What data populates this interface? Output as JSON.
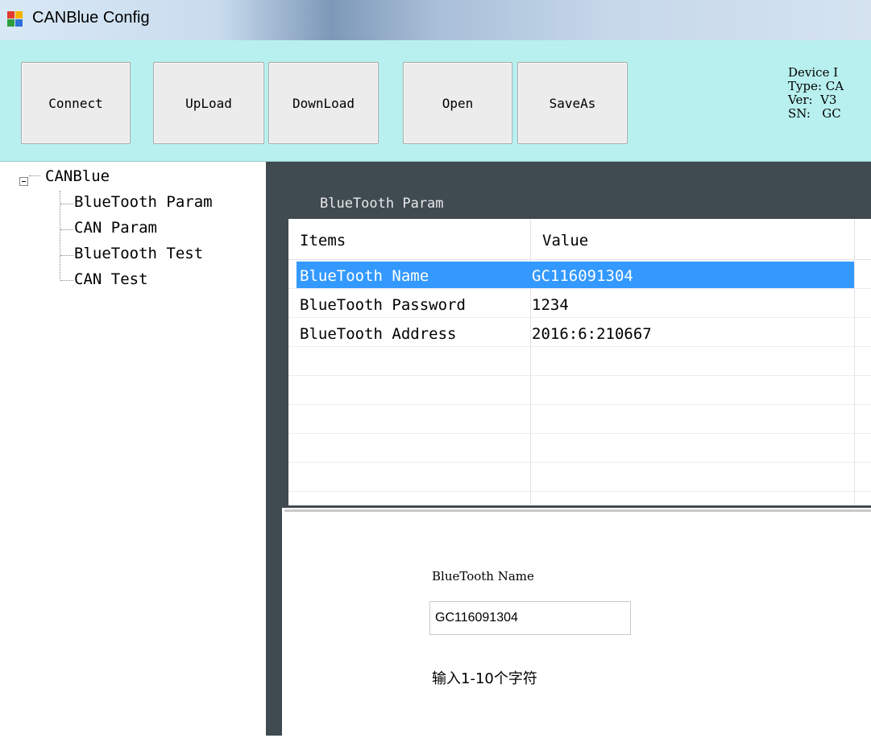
{
  "window": {
    "title": "CANBlue Config"
  },
  "toolbar": {
    "buttons": [
      {
        "label": "Connect"
      },
      {
        "label": "UpLoad"
      },
      {
        "label": "DownLoad"
      },
      {
        "label": "Open"
      },
      {
        "label": "SaveAs"
      }
    ]
  },
  "device_info": {
    "line1": "Device I",
    "line2": "Type: CA",
    "line3": "Ver:  V3",
    "line4": "SN:   GC"
  },
  "tree": {
    "root": "CANBlue",
    "items": [
      {
        "label": "BlueTooth Param"
      },
      {
        "label": "CAN Param"
      },
      {
        "label": "BlueTooth Test"
      },
      {
        "label": "CAN Test"
      }
    ]
  },
  "panel": {
    "title": "BlueTooth Param",
    "columns": [
      "Items",
      "Value"
    ],
    "rows": [
      {
        "item": "BlueTooth Name",
        "value": "GC116091304"
      },
      {
        "item": "BlueTooth Password",
        "value": "1234"
      },
      {
        "item": "BlueTooth Address",
        "value": "2016:6:210667"
      }
    ]
  },
  "editor": {
    "label": "BlueTooth Name",
    "value": "GC116091304",
    "hint": "输入1-10个字符"
  },
  "colors": {
    "toolbar_bg": "#b8f0ef",
    "panel_dark": "#3f4a51",
    "selection": "#3399ff"
  }
}
